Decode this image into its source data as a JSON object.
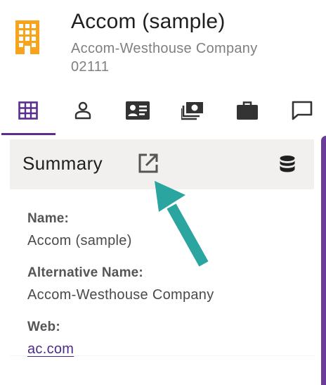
{
  "header": {
    "title": "Accom (sample)",
    "subtitle": "Accom-Westhouse Company 02111",
    "icon": "building-icon",
    "icon_color": "#f7a31c"
  },
  "tabs": [
    {
      "icon": "grid-icon",
      "selected": true
    },
    {
      "icon": "person-icon",
      "selected": false
    },
    {
      "icon": "contact-card-icon",
      "selected": false
    },
    {
      "icon": "money-icon",
      "selected": false
    },
    {
      "icon": "briefcase-icon",
      "selected": false
    },
    {
      "icon": "comment-icon",
      "selected": false
    }
  ],
  "summary": {
    "title": "Summary",
    "open_icon": "open-in-new-icon",
    "data_icon": "database-icon",
    "fields": [
      {
        "label": "Name:",
        "value": "Accom (sample)"
      },
      {
        "label": "Alternative Name:",
        "value": "Accom-Westhouse Company"
      },
      {
        "label": "Web:",
        "value": "ac.com"
      }
    ]
  },
  "colors": {
    "accent": "#5b2d8e",
    "arrow": "#2aa59f",
    "header_bg": "#f1f0ef"
  }
}
